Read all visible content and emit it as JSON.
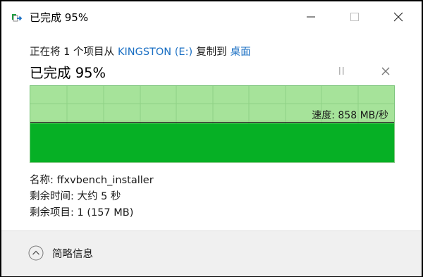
{
  "window": {
    "title": "已完成 95%",
    "icon": "copy-file-icon",
    "controls": [
      "minimize-icon",
      "maximize-icon",
      "close-icon"
    ]
  },
  "copy": {
    "prefix": "正在将 1 个项目从",
    "source": "KINGSTON (E:)",
    "middle": "复制到",
    "destination": "桌面",
    "status": "已完成 95%",
    "percent": 95
  },
  "graph": {
    "speed_label": "速度: 858 MB/秒",
    "colors": {
      "bg": "#a6e39a",
      "fill": "#06b025",
      "grid": "#8fd285"
    }
  },
  "info": {
    "name": "名称: ffxvbench_installer",
    "time_remaining": "剩余时间: 大约 5 秒",
    "items_remaining": "剩余项目: 1 (157 MB)"
  },
  "footer": {
    "details_label": "简略信息",
    "details_icon": "chevron-up-icon"
  },
  "colors": {
    "link": "#1a6fc3",
    "footer_bg": "#f0f0f0"
  }
}
